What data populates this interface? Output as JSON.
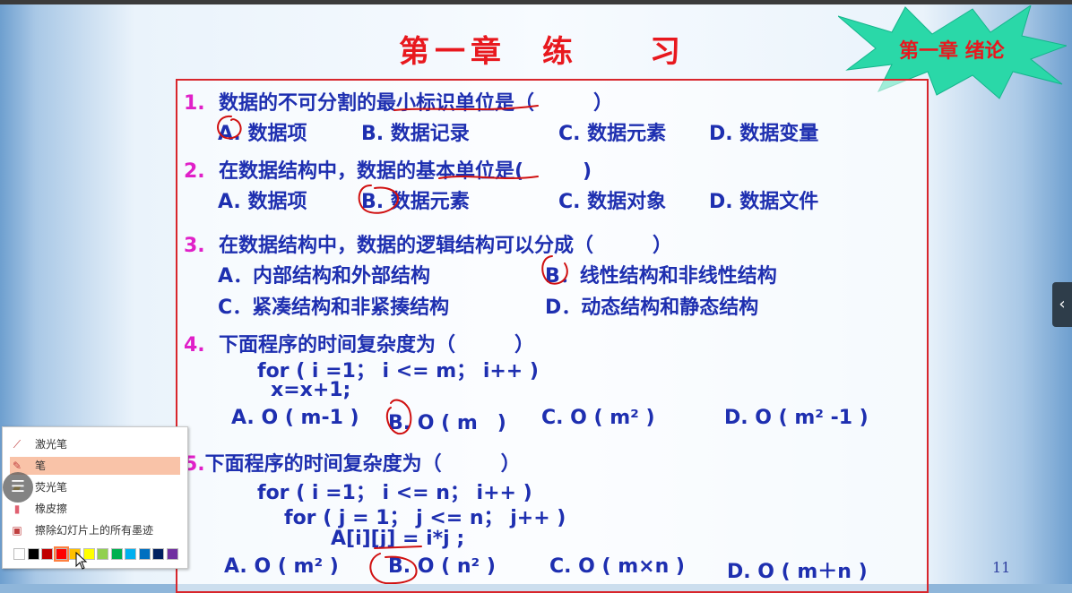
{
  "slide": {
    "title": "第一章　练　　习",
    "badge": "第一章 绪论",
    "page_number": "11",
    "questions": [
      {
        "num": "1.",
        "text": "数据的不可分割的最小标识单位是（　　　）",
        "options": [
          "A. 数据项",
          "B. 数据记录",
          "C. 数据元素",
          "D. 数据变量"
        ]
      },
      {
        "num": "2.",
        "text": "在数据结构中，数据的基本单位是(　　　)",
        "options": [
          "A. 数据项",
          "B. 数据元素",
          "C. 数据对象",
          "D. 数据文件"
        ]
      },
      {
        "num": "3.",
        "text": "在数据结构中，数据的逻辑结构可以分成（　　　）",
        "options": [
          "A．内部结构和外部结构",
          "B．线性结构和非线性结构",
          "C．紧凑结构和非紧揍结构",
          "D．动态结构和静态结构"
        ]
      },
      {
        "num": "4.",
        "text": "下面程序的时间复杂度为（　　　）",
        "code": [
          "for ( i =1； i <= m； i++ )",
          "x=x+1;"
        ],
        "options": [
          "A. O ( m-1 )",
          "B. O ( m　)",
          "C. O ( m² )",
          "D. O ( m² -1 )"
        ]
      },
      {
        "num": "5.",
        "text": "下面程序的时间复杂度为（　　　）",
        "code": [
          "for ( i =1； i <= n； i++ )",
          "for ( j = 1； j <= n； j++ )",
          "A[i][j] = i*j ;"
        ],
        "options": [
          "A. O ( m² )",
          "B. O ( n² )",
          "C. O ( m×n )",
          "D. O ( m＋n )"
        ]
      }
    ]
  },
  "pen_menu": {
    "items": [
      {
        "label": "激光笔",
        "icon": "laser-pointer-icon"
      },
      {
        "label": "笔",
        "icon": "pen-icon",
        "selected": true
      },
      {
        "label": "荧光笔",
        "icon": "highlighter-icon"
      },
      {
        "label": "橡皮擦",
        "icon": "eraser-icon"
      },
      {
        "label": "擦除幻灯片上的所有墨迹",
        "icon": "erase-all-icon"
      }
    ],
    "colors": [
      "#ffffff",
      "#000000",
      "#c00000",
      "#ff0000",
      "#ffc000",
      "#ffff00",
      "#92d050",
      "#00b050",
      "#00b0f0",
      "#0070c0",
      "#002060",
      "#7030a0"
    ],
    "selected_color": "#ff0000"
  },
  "colors": {
    "title": "#e8181e",
    "question": "#1e2fb0",
    "number": "#e020c8",
    "ink": "#d01010"
  }
}
